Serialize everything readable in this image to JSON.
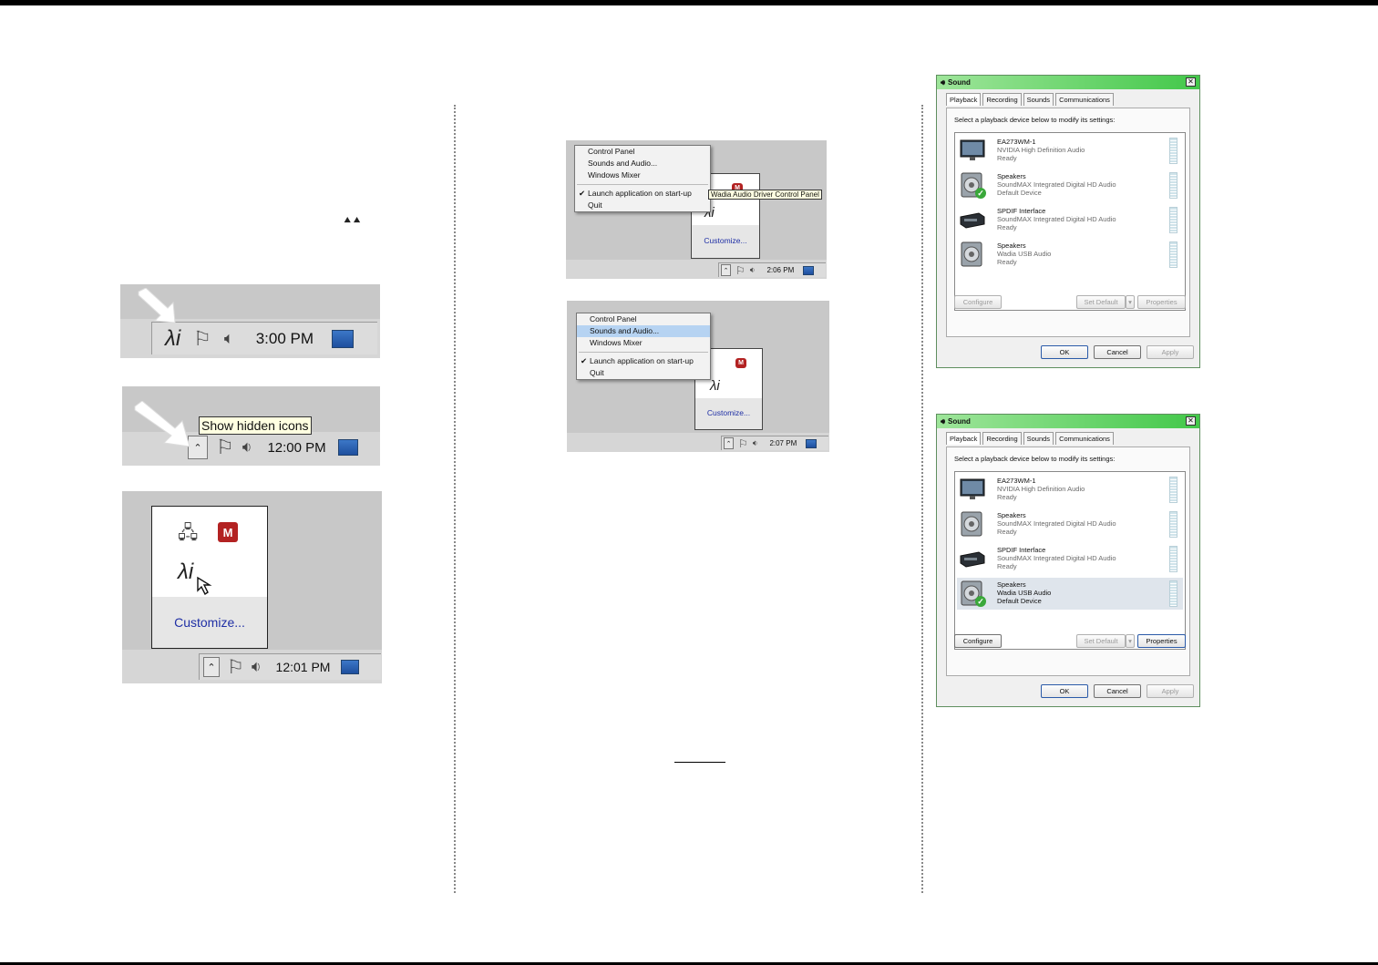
{
  "taskbar_shots": [
    {
      "clock": "3:00 PM"
    },
    {
      "clock": "12:00 PM",
      "tooltip": "Show hidden icons"
    },
    {
      "clock": "12:01 PM",
      "customize": "Customize..."
    }
  ],
  "menu_shots": [
    {
      "items": [
        "Control Panel",
        "Sounds and Audio...",
        "Windows Mixer",
        "Launch application on start-up",
        "Quit"
      ],
      "tooltip": "Wadia Audio Driver Control Panel",
      "customize": "Customize...",
      "clock": "2:06 PM"
    },
    {
      "items": [
        "Control Panel",
        "Sounds and Audio...",
        "Windows Mixer",
        "Launch application on start-up",
        "Quit"
      ],
      "customize": "Customize...",
      "clock": "2:07 PM",
      "highlighted": "Sounds and Audio..."
    }
  ],
  "sound_dialogs": [
    {
      "title": "Sound",
      "tabs": [
        "Playback",
        "Recording",
        "Sounds",
        "Communications"
      ],
      "instruction": "Select a playback device below to modify its settings:",
      "devices": [
        {
          "name": "EA273WM-1",
          "driver": "NVIDIA High Definition Audio",
          "status": "Ready"
        },
        {
          "name": "Speakers",
          "driver": "SoundMAX Integrated Digital HD Audio",
          "status": "Default Device"
        },
        {
          "name": "SPDIF Interface",
          "driver": "SoundMAX Integrated Digital HD Audio",
          "status": "Ready"
        },
        {
          "name": "Speakers",
          "driver": "Wadia USB Audio",
          "status": "Ready"
        }
      ],
      "buttons": {
        "configure": "Configure",
        "set_default": "Set Default",
        "properties": "Properties",
        "ok": "OK",
        "cancel": "Cancel",
        "apply": "Apply"
      }
    },
    {
      "title": "Sound",
      "tabs": [
        "Playback",
        "Recording",
        "Sounds",
        "Communications"
      ],
      "instruction": "Select a playback device below to modify its settings:",
      "devices": [
        {
          "name": "EA273WM-1",
          "driver": "NVIDIA High Definition Audio",
          "status": "Ready"
        },
        {
          "name": "Speakers",
          "driver": "SoundMAX Integrated Digital HD Audio",
          "status": "Ready"
        },
        {
          "name": "SPDIF Interface",
          "driver": "SoundMAX Integrated Digital HD Audio",
          "status": "Ready"
        },
        {
          "name": "Speakers",
          "driver": "Wadia USB Audio",
          "status": "Default Device"
        }
      ],
      "buttons": {
        "configure": "Configure",
        "set_default": "Set Default",
        "properties": "Properties",
        "ok": "OK",
        "cancel": "Cancel",
        "apply": "Apply"
      }
    }
  ],
  "colors": {
    "tray_bg": "#d6d6d6",
    "title_green": "#43c84a",
    "menu_highlight": "#b6d3f2",
    "link_blue": "#1f2fa5"
  }
}
